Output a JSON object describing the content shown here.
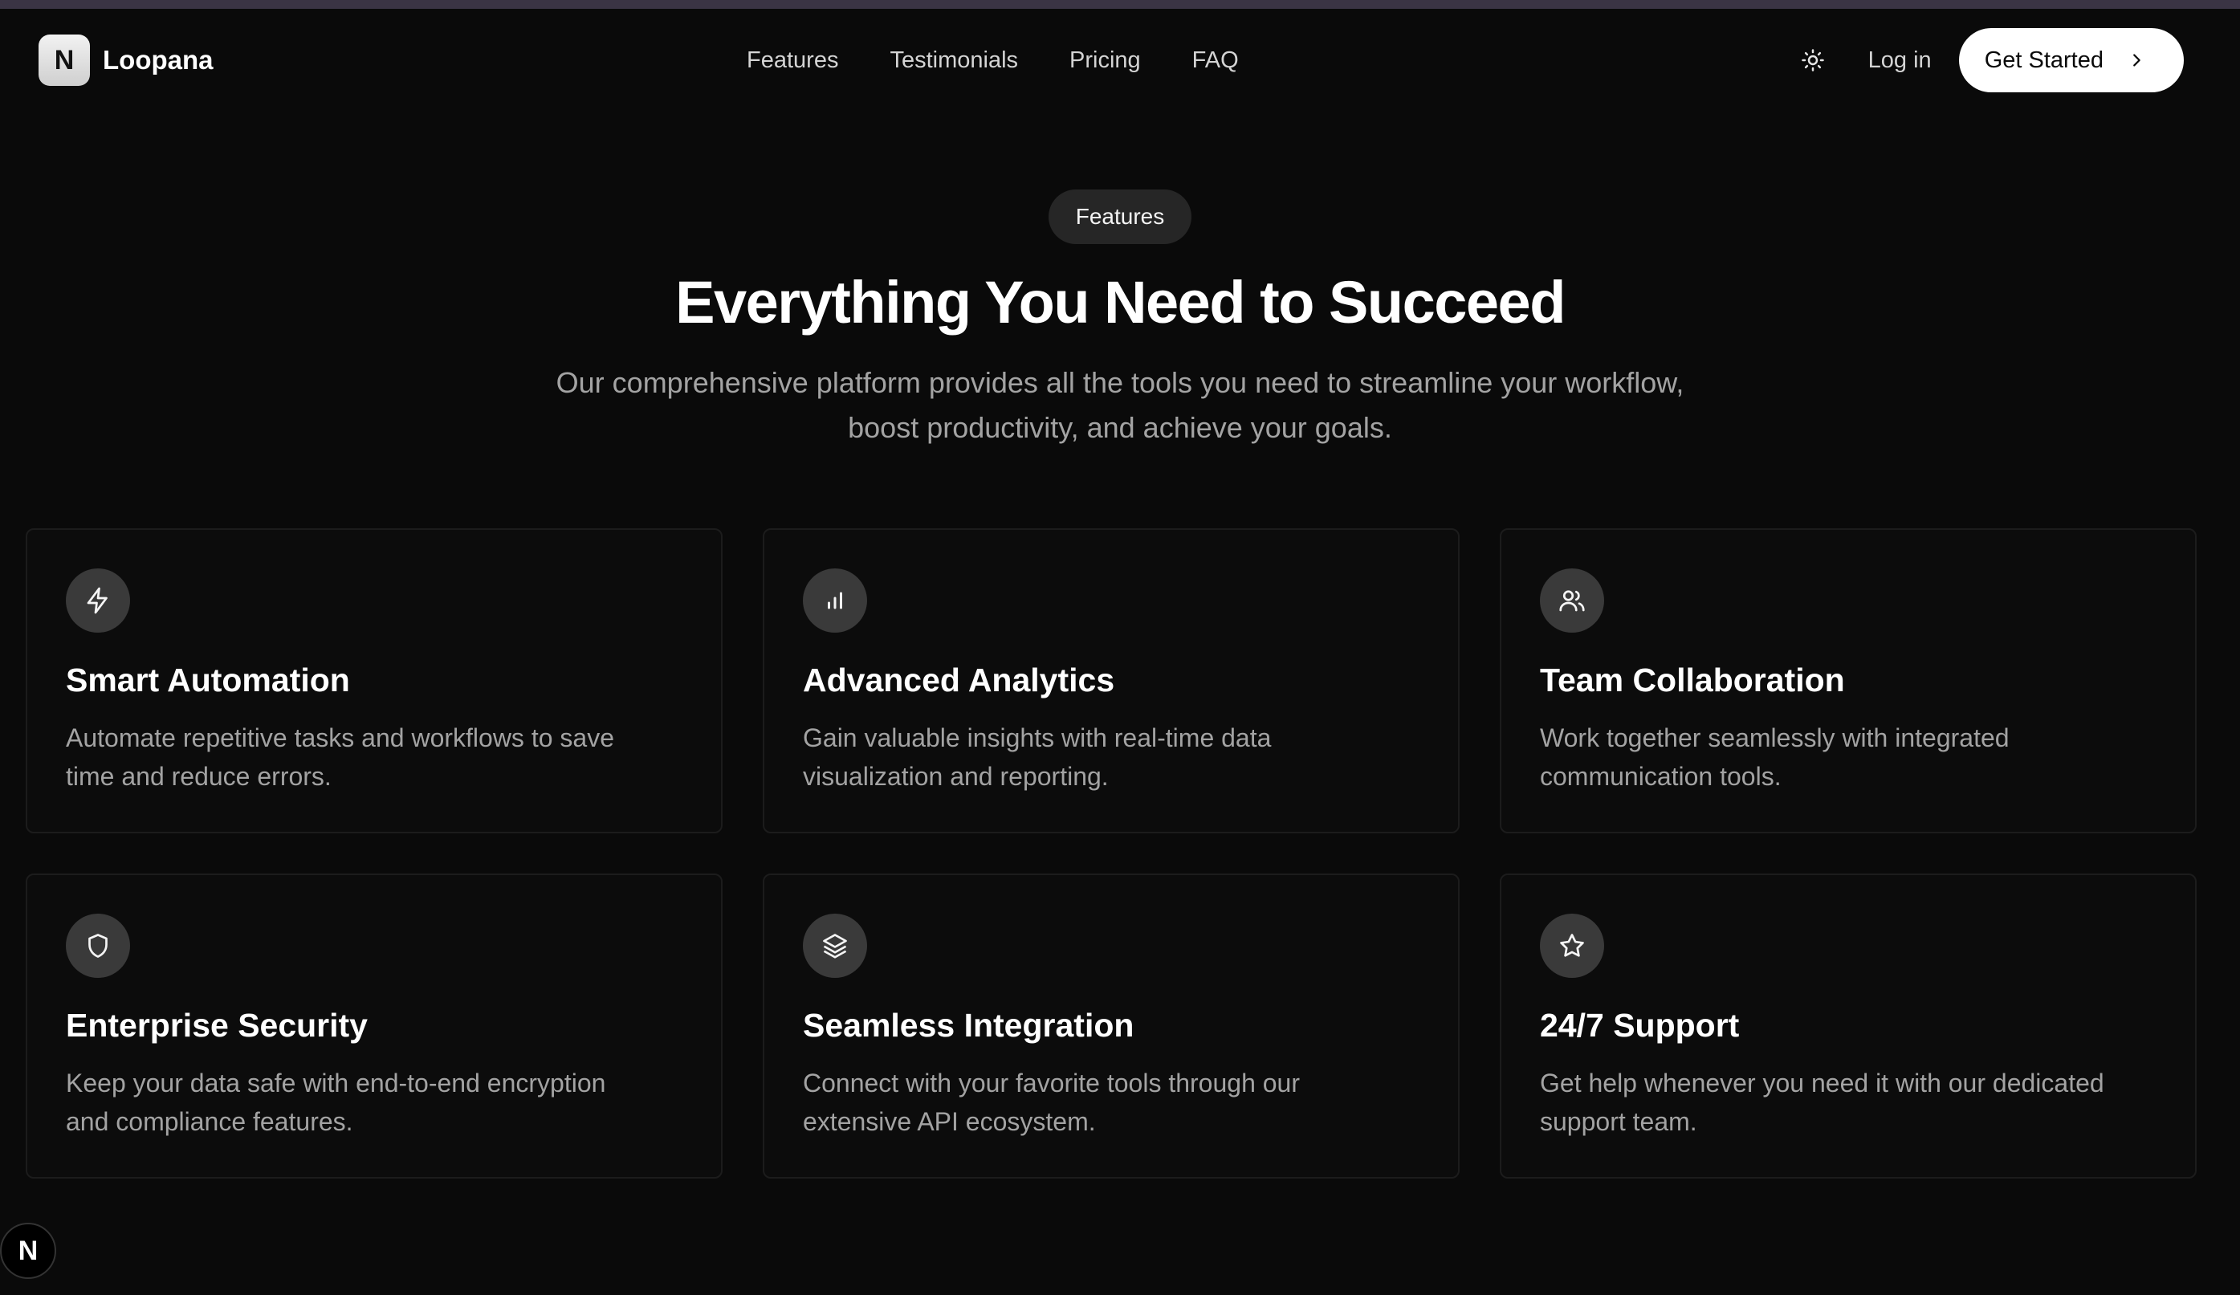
{
  "brand": {
    "logo_letter": "N",
    "name": "Loopana"
  },
  "nav": {
    "links": [
      {
        "label": "Features"
      },
      {
        "label": "Testimonials"
      },
      {
        "label": "Pricing"
      },
      {
        "label": "FAQ"
      }
    ],
    "theme_icon": "sun-icon",
    "login_label": "Log in",
    "cta_label": "Get Started"
  },
  "hero": {
    "pill": "Features",
    "title": "Everything You Need to Succeed",
    "subtitle_line1": "Our comprehensive platform provides all the tools you need to streamline your workflow,",
    "subtitle_line2": "boost productivity, and achieve your goals."
  },
  "features": [
    {
      "icon": "zap-icon",
      "title": "Smart Automation",
      "desc_line1": "Automate repetitive tasks and workflows to save",
      "desc_line2": "time and reduce errors."
    },
    {
      "icon": "bar-chart-icon",
      "title": "Advanced Analytics",
      "desc_line1": "Gain valuable insights with real-time data",
      "desc_line2": "visualization and reporting."
    },
    {
      "icon": "users-icon",
      "title": "Team Collaboration",
      "desc_line1": "Work together seamlessly with integrated",
      "desc_line2": "communication tools."
    },
    {
      "icon": "shield-icon",
      "title": "Enterprise Security",
      "desc_line1": "Keep your data safe with end-to-end encryption",
      "desc_line2": "and compliance features."
    },
    {
      "icon": "layers-icon",
      "title": "Seamless Integration",
      "desc_line1": "Connect with your favorite tools through our",
      "desc_line2": "extensive API ecosystem."
    },
    {
      "icon": "star-icon",
      "title": "24/7 Support",
      "desc_line1": "Get help whenever you need it with our dedicated",
      "desc_line2": "support team."
    }
  ],
  "dev_badge": {
    "letter": "N"
  },
  "colors": {
    "background": "#0a0a0a",
    "card_border": "#1c1c1c",
    "icon_bg": "#3a3a3a",
    "cta_bg": "#ffffff",
    "accent_bar": "#3a3444"
  }
}
